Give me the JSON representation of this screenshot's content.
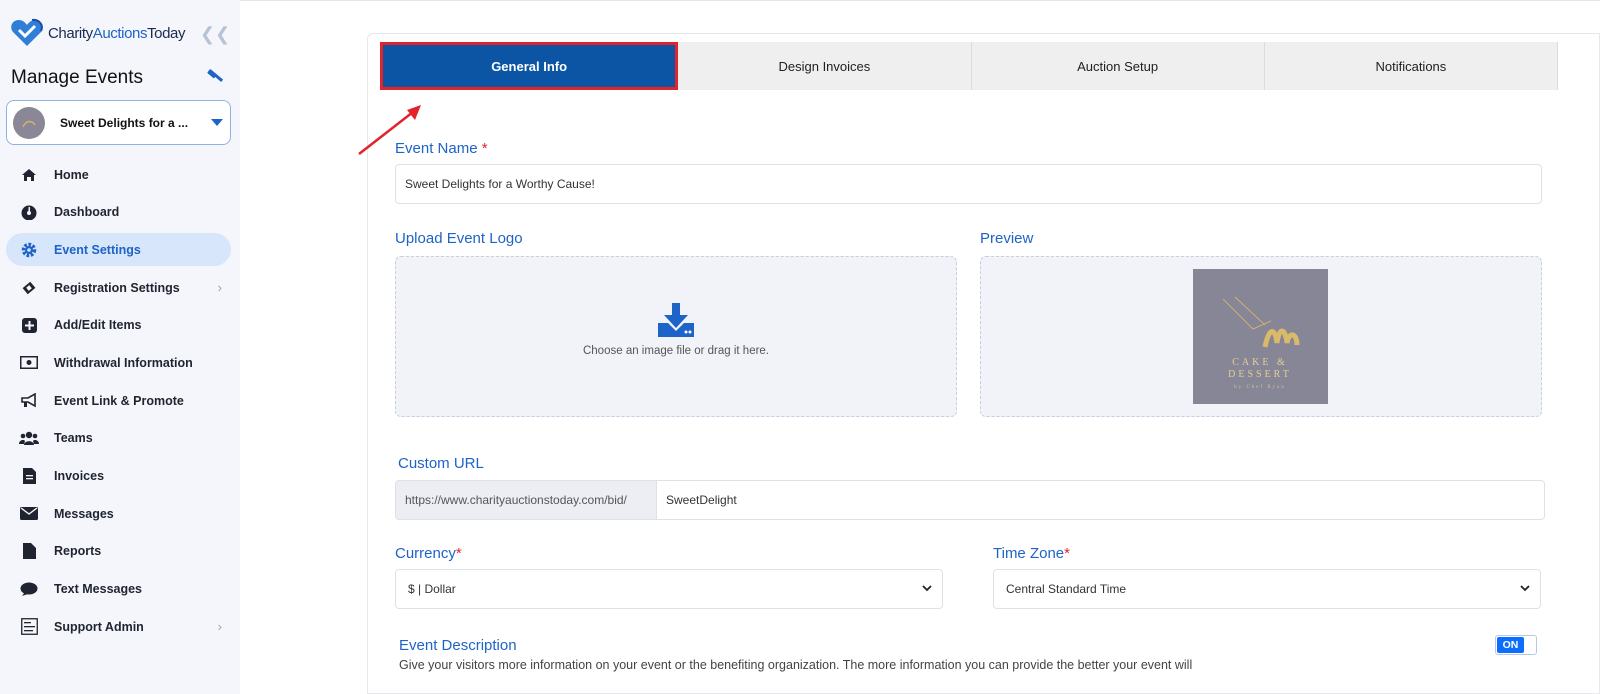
{
  "app": {
    "brand_part1": "Charity",
    "brand_part2": "Auctions",
    "brand_part3": "Today",
    "collapse_icon": "double-chevron-left-icon"
  },
  "sidebar": {
    "title": "Manage Events",
    "event_selector": {
      "label": "Sweet Delights for a ..."
    },
    "items": [
      {
        "label": "Home",
        "icon": "home-icon"
      },
      {
        "label": "Dashboard",
        "icon": "dashboard-icon"
      },
      {
        "label": "Event Settings",
        "icon": "gear-icon",
        "active": true
      },
      {
        "label": "Registration Settings",
        "icon": "ticket-icon",
        "has_submenu": true
      },
      {
        "label": "Add/Edit Items",
        "icon": "plus-square-icon"
      },
      {
        "label": "Withdrawal Information",
        "icon": "money-icon"
      },
      {
        "label": "Event Link & Promote",
        "icon": "megaphone-icon"
      },
      {
        "label": "Teams",
        "icon": "users-icon"
      },
      {
        "label": "Invoices",
        "icon": "invoice-icon"
      },
      {
        "label": "Messages",
        "icon": "envelope-icon"
      },
      {
        "label": "Reports",
        "icon": "file-icon"
      },
      {
        "label": "Text Messages",
        "icon": "comment-icon"
      },
      {
        "label": "Support Admin",
        "icon": "admin-icon",
        "has_submenu": true
      }
    ]
  },
  "tabs": [
    {
      "label": "General Info",
      "active": true
    },
    {
      "label": "Design Invoices"
    },
    {
      "label": "Auction Setup"
    },
    {
      "label": "Notifications"
    }
  ],
  "form": {
    "event_name_label": "Event Name",
    "event_name_value": "Sweet Delights for a Worthy Cause!",
    "upload_logo_label": "Upload Event Logo",
    "upload_hint": "Choose an image file or drag it here.",
    "preview_label": "Preview",
    "preview_logo": {
      "line1": "CAKE &",
      "line2": "DESSERT",
      "line3": "by Chef Ryan"
    },
    "custom_url_label": "Custom URL",
    "custom_url_prefix": "https://www.charityauctionstoday.com/bid/",
    "custom_url_value": "SweetDelight",
    "currency_label": "Currency",
    "currency_value": "$ | Dollar",
    "timezone_label": "Time Zone",
    "timezone_value": "Central Standard Time",
    "description_label": "Event Description",
    "description_help": "Give your visitors more information on your event or the benefiting organization.  The more information you can provide the better your event will",
    "description_toggle": "ON",
    "required_mark": "*"
  },
  "colors": {
    "accent": "#1e63c7",
    "tab_active": "#0b55a4",
    "highlight_red": "#e0242a"
  }
}
